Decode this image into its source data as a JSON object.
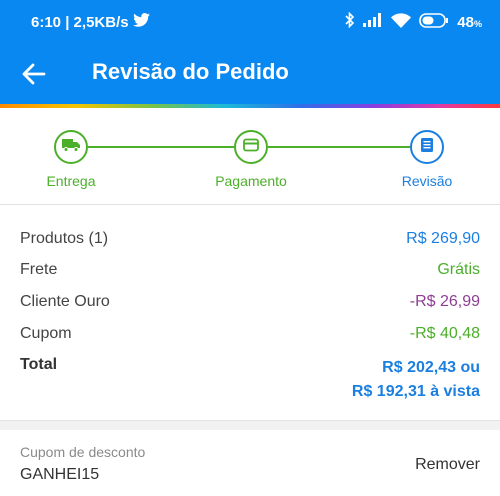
{
  "status_bar": {
    "time_speed": "6:10 | 2,5KB/s",
    "battery": "48",
    "battery_unit": "%",
    "icons": [
      "twitter-icon",
      "bluetooth-icon",
      "signal-icon",
      "wifi-icon",
      "battery-icon"
    ]
  },
  "app_bar": {
    "title": "Revisão do Pedido",
    "back_icon": "arrow-left-icon"
  },
  "stepper": {
    "steps": [
      {
        "label": "Entrega",
        "icon": "truck-icon",
        "state": "done"
      },
      {
        "label": "Pagamento",
        "icon": "credit-card-icon",
        "state": "done"
      },
      {
        "label": "Revisão",
        "icon": "receipt-icon",
        "state": "active"
      }
    ]
  },
  "summary": {
    "rows": [
      {
        "label": "Produtos (1)",
        "value": "R$ 269,90",
        "color": "#1b7fe0"
      },
      {
        "label": "Frete",
        "value": "Grátis",
        "color": "#4caf2a"
      },
      {
        "label": "Cliente Ouro",
        "value": "-R$ 26,99",
        "color": "#8e3e93"
      },
      {
        "label": "Cupom",
        "value": "-R$ 40,48",
        "color": "#4caf2a"
      }
    ],
    "total": {
      "label": "Total",
      "value_line1": "R$ 202,43 ou",
      "value_line2": "R$ 192,31 à vista"
    }
  },
  "coupon": {
    "label": "Cupom de desconto",
    "code": "GANHEI15",
    "remove_label": "Remover"
  },
  "colors": {
    "header": "#0a88f2",
    "success_green": "#4caf2a",
    "accent_blue": "#1b7fe0",
    "gold_purple": "#8e3e93"
  }
}
